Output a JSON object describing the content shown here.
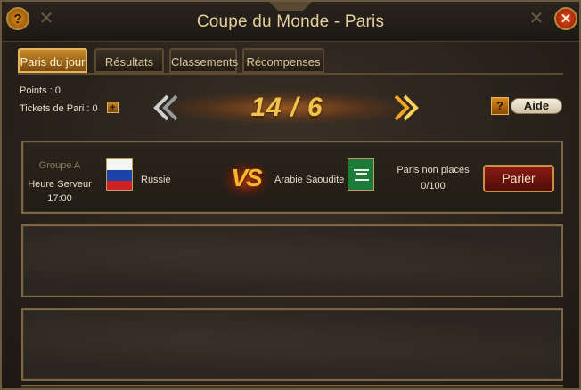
{
  "window": {
    "title": "Coupe du Monde - Paris"
  },
  "titlebar": {
    "help_icon": "question-icon",
    "close_icon": "close-icon",
    "help_glyph": "?",
    "close_glyph": "✕"
  },
  "tabs": [
    {
      "label": "Paris du jour",
      "active": true
    },
    {
      "label": "Résultats",
      "active": false
    },
    {
      "label": "Classements",
      "active": false
    },
    {
      "label": "Récompenses",
      "active": false
    }
  ],
  "stats": {
    "points": "Points : 0",
    "tickets": "Tickets de Pari : 0",
    "plus_glyph": "+"
  },
  "pager": {
    "display": "14 / 6",
    "prev_icon": "double-chevron-left-icon",
    "next_icon": "double-chevron-right-icon"
  },
  "help": {
    "q_glyph": "?",
    "label": "Aide"
  },
  "matches": [
    {
      "group": "Groupe A",
      "time_label": "Heure Serveur",
      "time": "17:00",
      "team1": "Russie",
      "vs": "VS",
      "team2": "Arabie Saoudite",
      "status": "Paris non placés",
      "count": "0/100",
      "button": "Parier"
    }
  ],
  "colors": {
    "accent_gold": "#f2c24a",
    "tab_active": "#c78a2a",
    "button_red": "#8a1a12",
    "frame": "#7b6647"
  }
}
